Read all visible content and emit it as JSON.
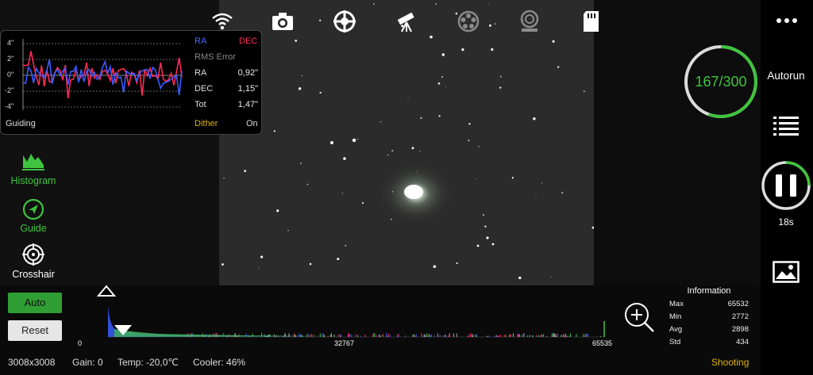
{
  "guiding": {
    "ra_legend": "RA",
    "dec_legend": "DEC",
    "rms_title": "RMS Error",
    "rows": [
      {
        "label": "RA",
        "value": "0,92\""
      },
      {
        "label": "DEC",
        "value": "1,15\""
      },
      {
        "label": "Tot",
        "value": "1,47\""
      }
    ],
    "y_ticks": [
      "4\"",
      "2\"",
      "0\"",
      "-2\"",
      "-4\""
    ],
    "title": "Guiding",
    "dither_label": "Dither",
    "dither_value": "On",
    "colors": {
      "ra": "#3c5cff",
      "dec": "#ff2a55"
    }
  },
  "tools": [
    {
      "label": "Histogram",
      "icon": "histogram-icon",
      "color": "#3fc43f"
    },
    {
      "label": "Guide",
      "icon": "compass-icon",
      "color": "#3fc43f"
    },
    {
      "label": "Crosshair",
      "icon": "crosshair-icon",
      "color": "#ffffff"
    }
  ],
  "top_icons": [
    "wifi-icon",
    "camera-icon",
    "focuser-icon",
    "telescope-icon",
    "filter-wheel-icon",
    "rotator-icon",
    "sd-card-icon"
  ],
  "sequence": {
    "progress_text": "167/300",
    "done": 167,
    "total": 300,
    "autorun_label": "Autorun",
    "exposure_remaining": "18s"
  },
  "histogram": {
    "auto_label": "Auto",
    "reset_label": "Reset",
    "axis": [
      "0",
      "32767",
      "65535"
    ]
  },
  "information": {
    "title": "Information",
    "rows": [
      {
        "label": "Max",
        "value": "65532"
      },
      {
        "label": "Min",
        "value": "2772"
      },
      {
        "label": "Avg",
        "value": "2898"
      },
      {
        "label": "Std",
        "value": "434"
      }
    ]
  },
  "status_bar": {
    "resolution": "3008x3008",
    "gain": "Gain: 0",
    "temp": "Temp: -20,0℃",
    "cooler": "Cooler: 46%",
    "state": "Shooting"
  },
  "accent": "#3fc43f",
  "state_color": "#e0b400"
}
